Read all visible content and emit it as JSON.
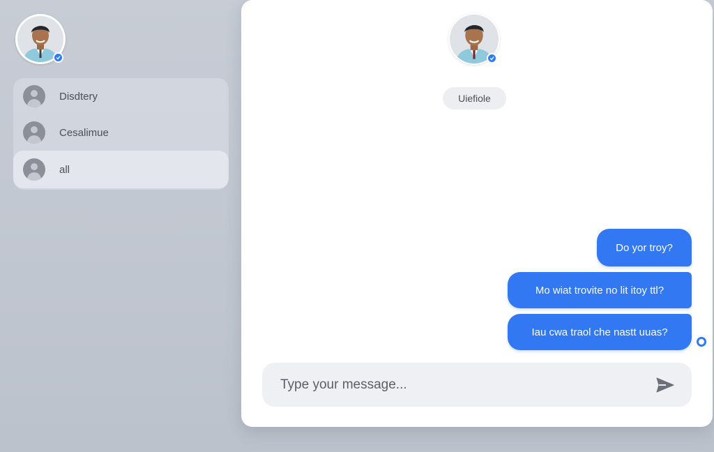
{
  "sidebar": {
    "contacts": [
      {
        "label": "Disdtery"
      },
      {
        "label": "Cesalimue"
      },
      {
        "label": "all"
      }
    ]
  },
  "chat": {
    "contact_name": "Uiefiole",
    "messages": [
      {
        "text": "Do yor troy?"
      },
      {
        "text": "Mo wiat trovite no lit itoy ttl?"
      },
      {
        "text": "Iau cwa traol che nastt uuas?"
      }
    ],
    "composer": {
      "placeholder": "Type your message..."
    }
  },
  "colors": {
    "accent": "#3178f2",
    "badge": "#2f7bf6"
  },
  "icons": {
    "send": "send-icon",
    "verified": "verified-badge-icon"
  }
}
